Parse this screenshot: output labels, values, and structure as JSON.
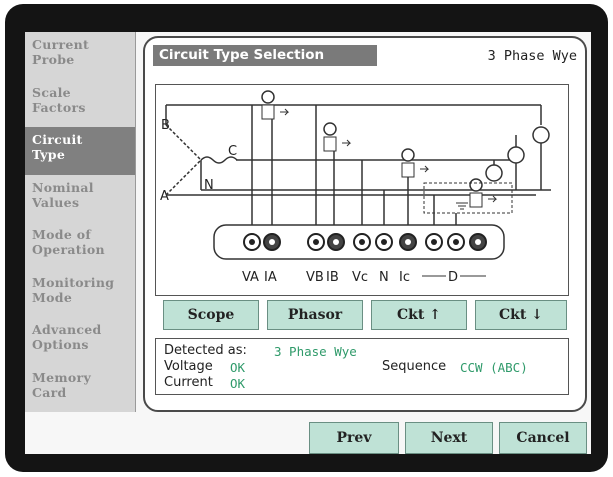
{
  "sidebar": {
    "items": [
      {
        "label": "Current\nProbe",
        "active": false
      },
      {
        "label": "Scale\nFactors",
        "active": false
      },
      {
        "label": "Circuit\nType",
        "active": true
      },
      {
        "label": "Nominal\nValues",
        "active": false
      },
      {
        "label": "Mode of\nOperation",
        "active": false
      },
      {
        "label": "Monitoring\nMode",
        "active": false
      },
      {
        "label": "Advanced\nOptions",
        "active": false
      },
      {
        "label": "Memory\nCard",
        "active": false
      }
    ]
  },
  "header": {
    "title": "Circuit Type Selection",
    "circuit_type": "3 Phase Wye"
  },
  "diagram": {
    "phase_labels": [
      "B",
      "C",
      "N",
      "A"
    ],
    "terminal_labels": [
      "VA",
      "IA",
      "VB",
      "IB",
      "Vc",
      "N",
      "Ic",
      "D"
    ],
    "lamps": 3,
    "probes": 4
  },
  "buttons": {
    "scope": "Scope",
    "phasor": "Phasor",
    "ckt_up": "Ckt ↑",
    "ckt_down": "Ckt ↓"
  },
  "status": {
    "detected_label": "Detected as:",
    "detected_value": "3 Phase Wye",
    "voltage_label": "Voltage",
    "voltage_value": "OK",
    "current_label": "Current",
    "current_value": "OK",
    "sequence_label": "Sequence",
    "sequence_value": "CCW (ABC)"
  },
  "nav": {
    "prev": "Prev",
    "next": "Next",
    "cancel": "Cancel"
  },
  "colors": {
    "button_fill": "#bfe2d6",
    "ok_text": "#2f9a6a",
    "active_item": "#808080"
  }
}
